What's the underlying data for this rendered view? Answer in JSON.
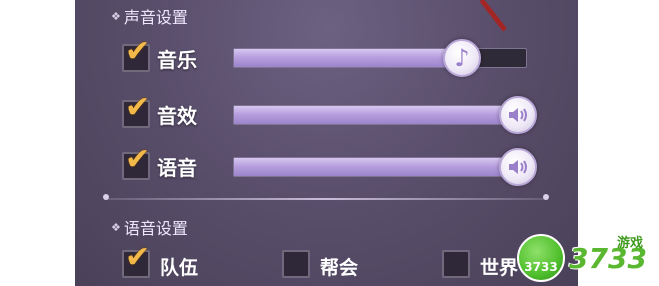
{
  "sound_section": {
    "title": "声音设置",
    "rows": [
      {
        "label": "音乐",
        "checked": true,
        "level": 0.81,
        "knob_icon": "music-note-icon"
      },
      {
        "label": "音效",
        "checked": true,
        "level": 1.0,
        "knob_icon": "speaker-icon"
      },
      {
        "label": "语音",
        "checked": true,
        "level": 1.0,
        "knob_icon": "speaker-icon"
      }
    ]
  },
  "voice_section": {
    "title": "语音设置",
    "options": [
      {
        "label": "队伍",
        "checked": true
      },
      {
        "label": "帮会",
        "checked": false
      },
      {
        "label": "世界",
        "checked": false
      }
    ]
  },
  "watermark": {
    "badge": "3733",
    "brand": "3733",
    "sub": "游戏"
  },
  "colors": {
    "accent_check": "#f2b84a",
    "slider_fill": "#b49cdd",
    "panel_bg": "#5a4f6c"
  }
}
